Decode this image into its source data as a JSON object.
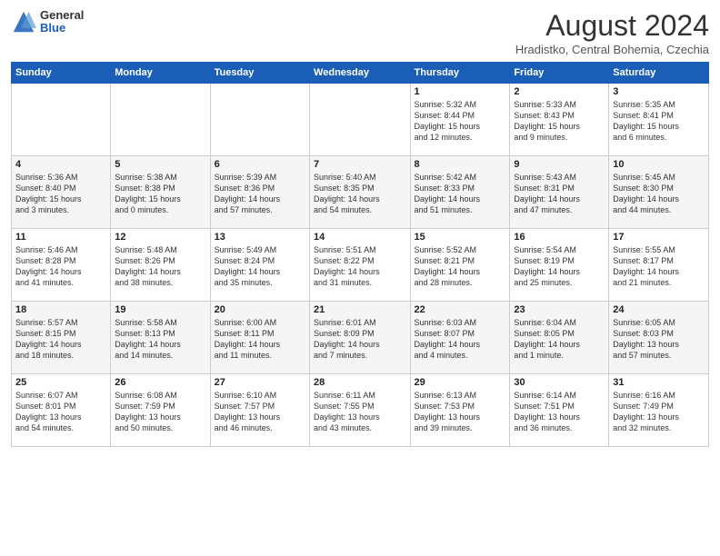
{
  "header": {
    "logo_general": "General",
    "logo_blue": "Blue",
    "month": "August 2024",
    "location": "Hradistko, Central Bohemia, Czechia"
  },
  "weekdays": [
    "Sunday",
    "Monday",
    "Tuesday",
    "Wednesday",
    "Thursday",
    "Friday",
    "Saturday"
  ],
  "weeks": [
    [
      {
        "day": "",
        "info": ""
      },
      {
        "day": "",
        "info": ""
      },
      {
        "day": "",
        "info": ""
      },
      {
        "day": "",
        "info": ""
      },
      {
        "day": "1",
        "info": "Sunrise: 5:32 AM\nSunset: 8:44 PM\nDaylight: 15 hours\nand 12 minutes."
      },
      {
        "day": "2",
        "info": "Sunrise: 5:33 AM\nSunset: 8:43 PM\nDaylight: 15 hours\nand 9 minutes."
      },
      {
        "day": "3",
        "info": "Sunrise: 5:35 AM\nSunset: 8:41 PM\nDaylight: 15 hours\nand 6 minutes."
      }
    ],
    [
      {
        "day": "4",
        "info": "Sunrise: 5:36 AM\nSunset: 8:40 PM\nDaylight: 15 hours\nand 3 minutes."
      },
      {
        "day": "5",
        "info": "Sunrise: 5:38 AM\nSunset: 8:38 PM\nDaylight: 15 hours\nand 0 minutes."
      },
      {
        "day": "6",
        "info": "Sunrise: 5:39 AM\nSunset: 8:36 PM\nDaylight: 14 hours\nand 57 minutes."
      },
      {
        "day": "7",
        "info": "Sunrise: 5:40 AM\nSunset: 8:35 PM\nDaylight: 14 hours\nand 54 minutes."
      },
      {
        "day": "8",
        "info": "Sunrise: 5:42 AM\nSunset: 8:33 PM\nDaylight: 14 hours\nand 51 minutes."
      },
      {
        "day": "9",
        "info": "Sunrise: 5:43 AM\nSunset: 8:31 PM\nDaylight: 14 hours\nand 47 minutes."
      },
      {
        "day": "10",
        "info": "Sunrise: 5:45 AM\nSunset: 8:30 PM\nDaylight: 14 hours\nand 44 minutes."
      }
    ],
    [
      {
        "day": "11",
        "info": "Sunrise: 5:46 AM\nSunset: 8:28 PM\nDaylight: 14 hours\nand 41 minutes."
      },
      {
        "day": "12",
        "info": "Sunrise: 5:48 AM\nSunset: 8:26 PM\nDaylight: 14 hours\nand 38 minutes."
      },
      {
        "day": "13",
        "info": "Sunrise: 5:49 AM\nSunset: 8:24 PM\nDaylight: 14 hours\nand 35 minutes."
      },
      {
        "day": "14",
        "info": "Sunrise: 5:51 AM\nSunset: 8:22 PM\nDaylight: 14 hours\nand 31 minutes."
      },
      {
        "day": "15",
        "info": "Sunrise: 5:52 AM\nSunset: 8:21 PM\nDaylight: 14 hours\nand 28 minutes."
      },
      {
        "day": "16",
        "info": "Sunrise: 5:54 AM\nSunset: 8:19 PM\nDaylight: 14 hours\nand 25 minutes."
      },
      {
        "day": "17",
        "info": "Sunrise: 5:55 AM\nSunset: 8:17 PM\nDaylight: 14 hours\nand 21 minutes."
      }
    ],
    [
      {
        "day": "18",
        "info": "Sunrise: 5:57 AM\nSunset: 8:15 PM\nDaylight: 14 hours\nand 18 minutes."
      },
      {
        "day": "19",
        "info": "Sunrise: 5:58 AM\nSunset: 8:13 PM\nDaylight: 14 hours\nand 14 minutes."
      },
      {
        "day": "20",
        "info": "Sunrise: 6:00 AM\nSunset: 8:11 PM\nDaylight: 14 hours\nand 11 minutes."
      },
      {
        "day": "21",
        "info": "Sunrise: 6:01 AM\nSunset: 8:09 PM\nDaylight: 14 hours\nand 7 minutes."
      },
      {
        "day": "22",
        "info": "Sunrise: 6:03 AM\nSunset: 8:07 PM\nDaylight: 14 hours\nand 4 minutes."
      },
      {
        "day": "23",
        "info": "Sunrise: 6:04 AM\nSunset: 8:05 PM\nDaylight: 14 hours\nand 1 minute."
      },
      {
        "day": "24",
        "info": "Sunrise: 6:05 AM\nSunset: 8:03 PM\nDaylight: 13 hours\nand 57 minutes."
      }
    ],
    [
      {
        "day": "25",
        "info": "Sunrise: 6:07 AM\nSunset: 8:01 PM\nDaylight: 13 hours\nand 54 minutes."
      },
      {
        "day": "26",
        "info": "Sunrise: 6:08 AM\nSunset: 7:59 PM\nDaylight: 13 hours\nand 50 minutes."
      },
      {
        "day": "27",
        "info": "Sunrise: 6:10 AM\nSunset: 7:57 PM\nDaylight: 13 hours\nand 46 minutes."
      },
      {
        "day": "28",
        "info": "Sunrise: 6:11 AM\nSunset: 7:55 PM\nDaylight: 13 hours\nand 43 minutes."
      },
      {
        "day": "29",
        "info": "Sunrise: 6:13 AM\nSunset: 7:53 PM\nDaylight: 13 hours\nand 39 minutes."
      },
      {
        "day": "30",
        "info": "Sunrise: 6:14 AM\nSunset: 7:51 PM\nDaylight: 13 hours\nand 36 minutes."
      },
      {
        "day": "31",
        "info": "Sunrise: 6:16 AM\nSunset: 7:49 PM\nDaylight: 13 hours\nand 32 minutes."
      }
    ]
  ]
}
